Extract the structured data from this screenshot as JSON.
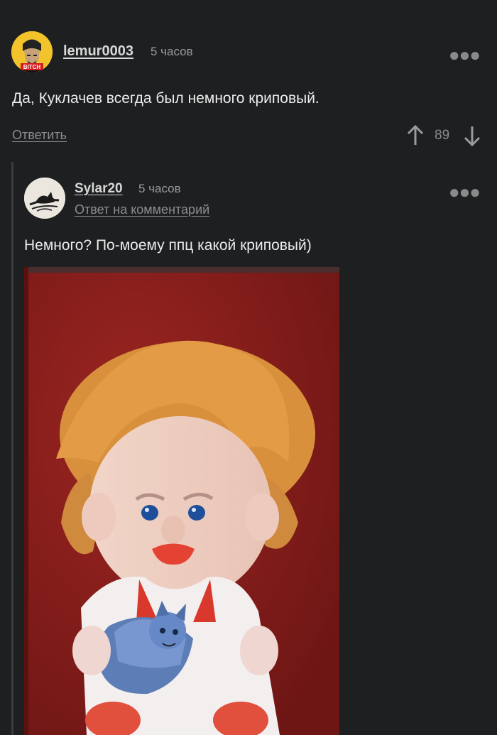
{
  "comment": {
    "username": "lemur0003",
    "time": "5 часов",
    "text": "Да, Куклачев всегда был немного криповый.",
    "reply_label": "Ответить",
    "rating": "89",
    "avatar_badge": "BITCH"
  },
  "reply": {
    "username": "Sylar20",
    "time": "5 часов",
    "reply_to_label": "Ответ на комментарий",
    "text": "Немного? По-моему ппц какой криповый)"
  },
  "icons": {
    "more": "more-horizontal-icon",
    "upvote": "arrow-up-icon",
    "downvote": "arrow-down-icon"
  },
  "colors": {
    "background": "#1d1f21",
    "muted": "#8d8d8d",
    "avatar_yellow": "#f3c32b",
    "photo_wall": "#8a1f1c",
    "doll_hair": "#d98a34"
  }
}
